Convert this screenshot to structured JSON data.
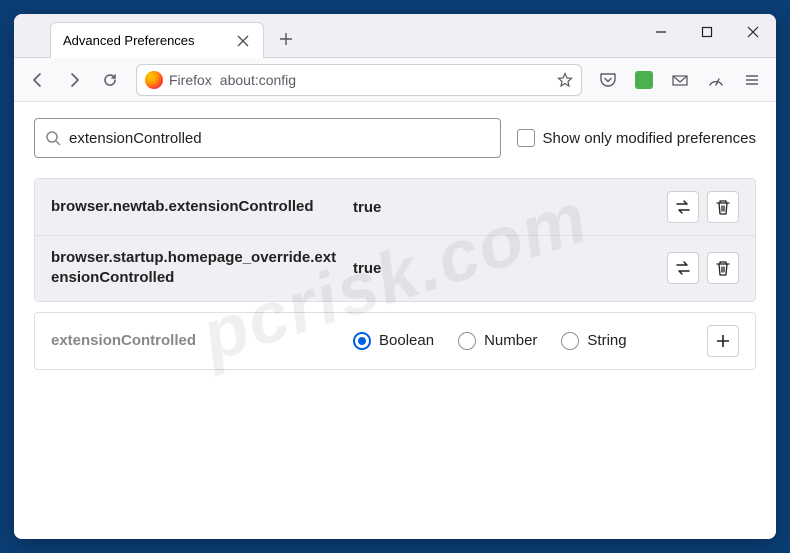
{
  "window": {
    "controls": {
      "min": "−",
      "max": "□",
      "close": "✕"
    }
  },
  "tab": {
    "title": "Advanced Preferences"
  },
  "urlbar": {
    "identity_label": "Firefox",
    "url": "about:config"
  },
  "config": {
    "search_value": "extensionControlled",
    "show_modified_label": "Show only modified preferences",
    "rows": [
      {
        "name": "browser.newtab.extensionControlled",
        "value": "true"
      },
      {
        "name": "browser.startup.homepage_override.extensionControlled",
        "value": "true"
      }
    ],
    "add": {
      "name": "extensionControlled",
      "types": {
        "boolean": "Boolean",
        "number": "Number",
        "string": "String"
      },
      "selected": "boolean"
    }
  },
  "watermark": "pcrisk.com"
}
